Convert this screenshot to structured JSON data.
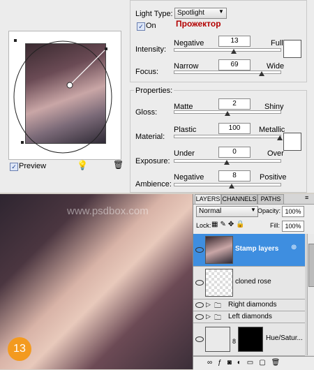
{
  "lighting": {
    "light_type_label": "Light Type:",
    "light_type_value": "Spotlight",
    "annotation": "Прожектор",
    "on_label": "On",
    "intensity_label": "Intensity:",
    "intensity_min": "Negative",
    "intensity_max": "Full",
    "intensity_value": "13",
    "focus_label": "Focus:",
    "focus_min": "Narrow",
    "focus_max": "Wide",
    "focus_value": "69",
    "properties_label": "Properties:",
    "gloss_label": "Gloss:",
    "gloss_min": "Matte",
    "gloss_max": "Shiny",
    "gloss_value": "2",
    "material_label": "Material:",
    "material_min": "Plastic",
    "material_max": "Metallic",
    "material_value": "100",
    "exposure_label": "Exposure:",
    "exposure_min": "Under",
    "exposure_max": "Over",
    "exposure_value": "0",
    "ambience_label": "Ambience:",
    "ambience_min": "Negative",
    "ambience_max": "Positive",
    "ambience_value": "8",
    "preview_label": "Preview"
  },
  "image": {
    "watermark": "www.psdbox.com",
    "step_number": "13"
  },
  "layers": {
    "tabs": [
      "LAYERS",
      "CHANNELS",
      "PATHS"
    ],
    "blend_mode": "Normal",
    "opacity_label": "Opacity:",
    "opacity_value": "100%",
    "lock_label": "Lock:",
    "fill_label": "Fill:",
    "fill_value": "100%",
    "items": [
      {
        "name": "Stamp layers",
        "selected": true
      },
      {
        "name": "cloned rose",
        "selected": false
      },
      {
        "name": "Right diamonds",
        "selected": false
      },
      {
        "name": "Left diamonds",
        "selected": false
      },
      {
        "name": "Hue/Satur...",
        "selected": false
      }
    ]
  },
  "colors": {
    "selection": "#3e8ee0",
    "badge": "#f39a1f",
    "annotation": "#b30000"
  }
}
